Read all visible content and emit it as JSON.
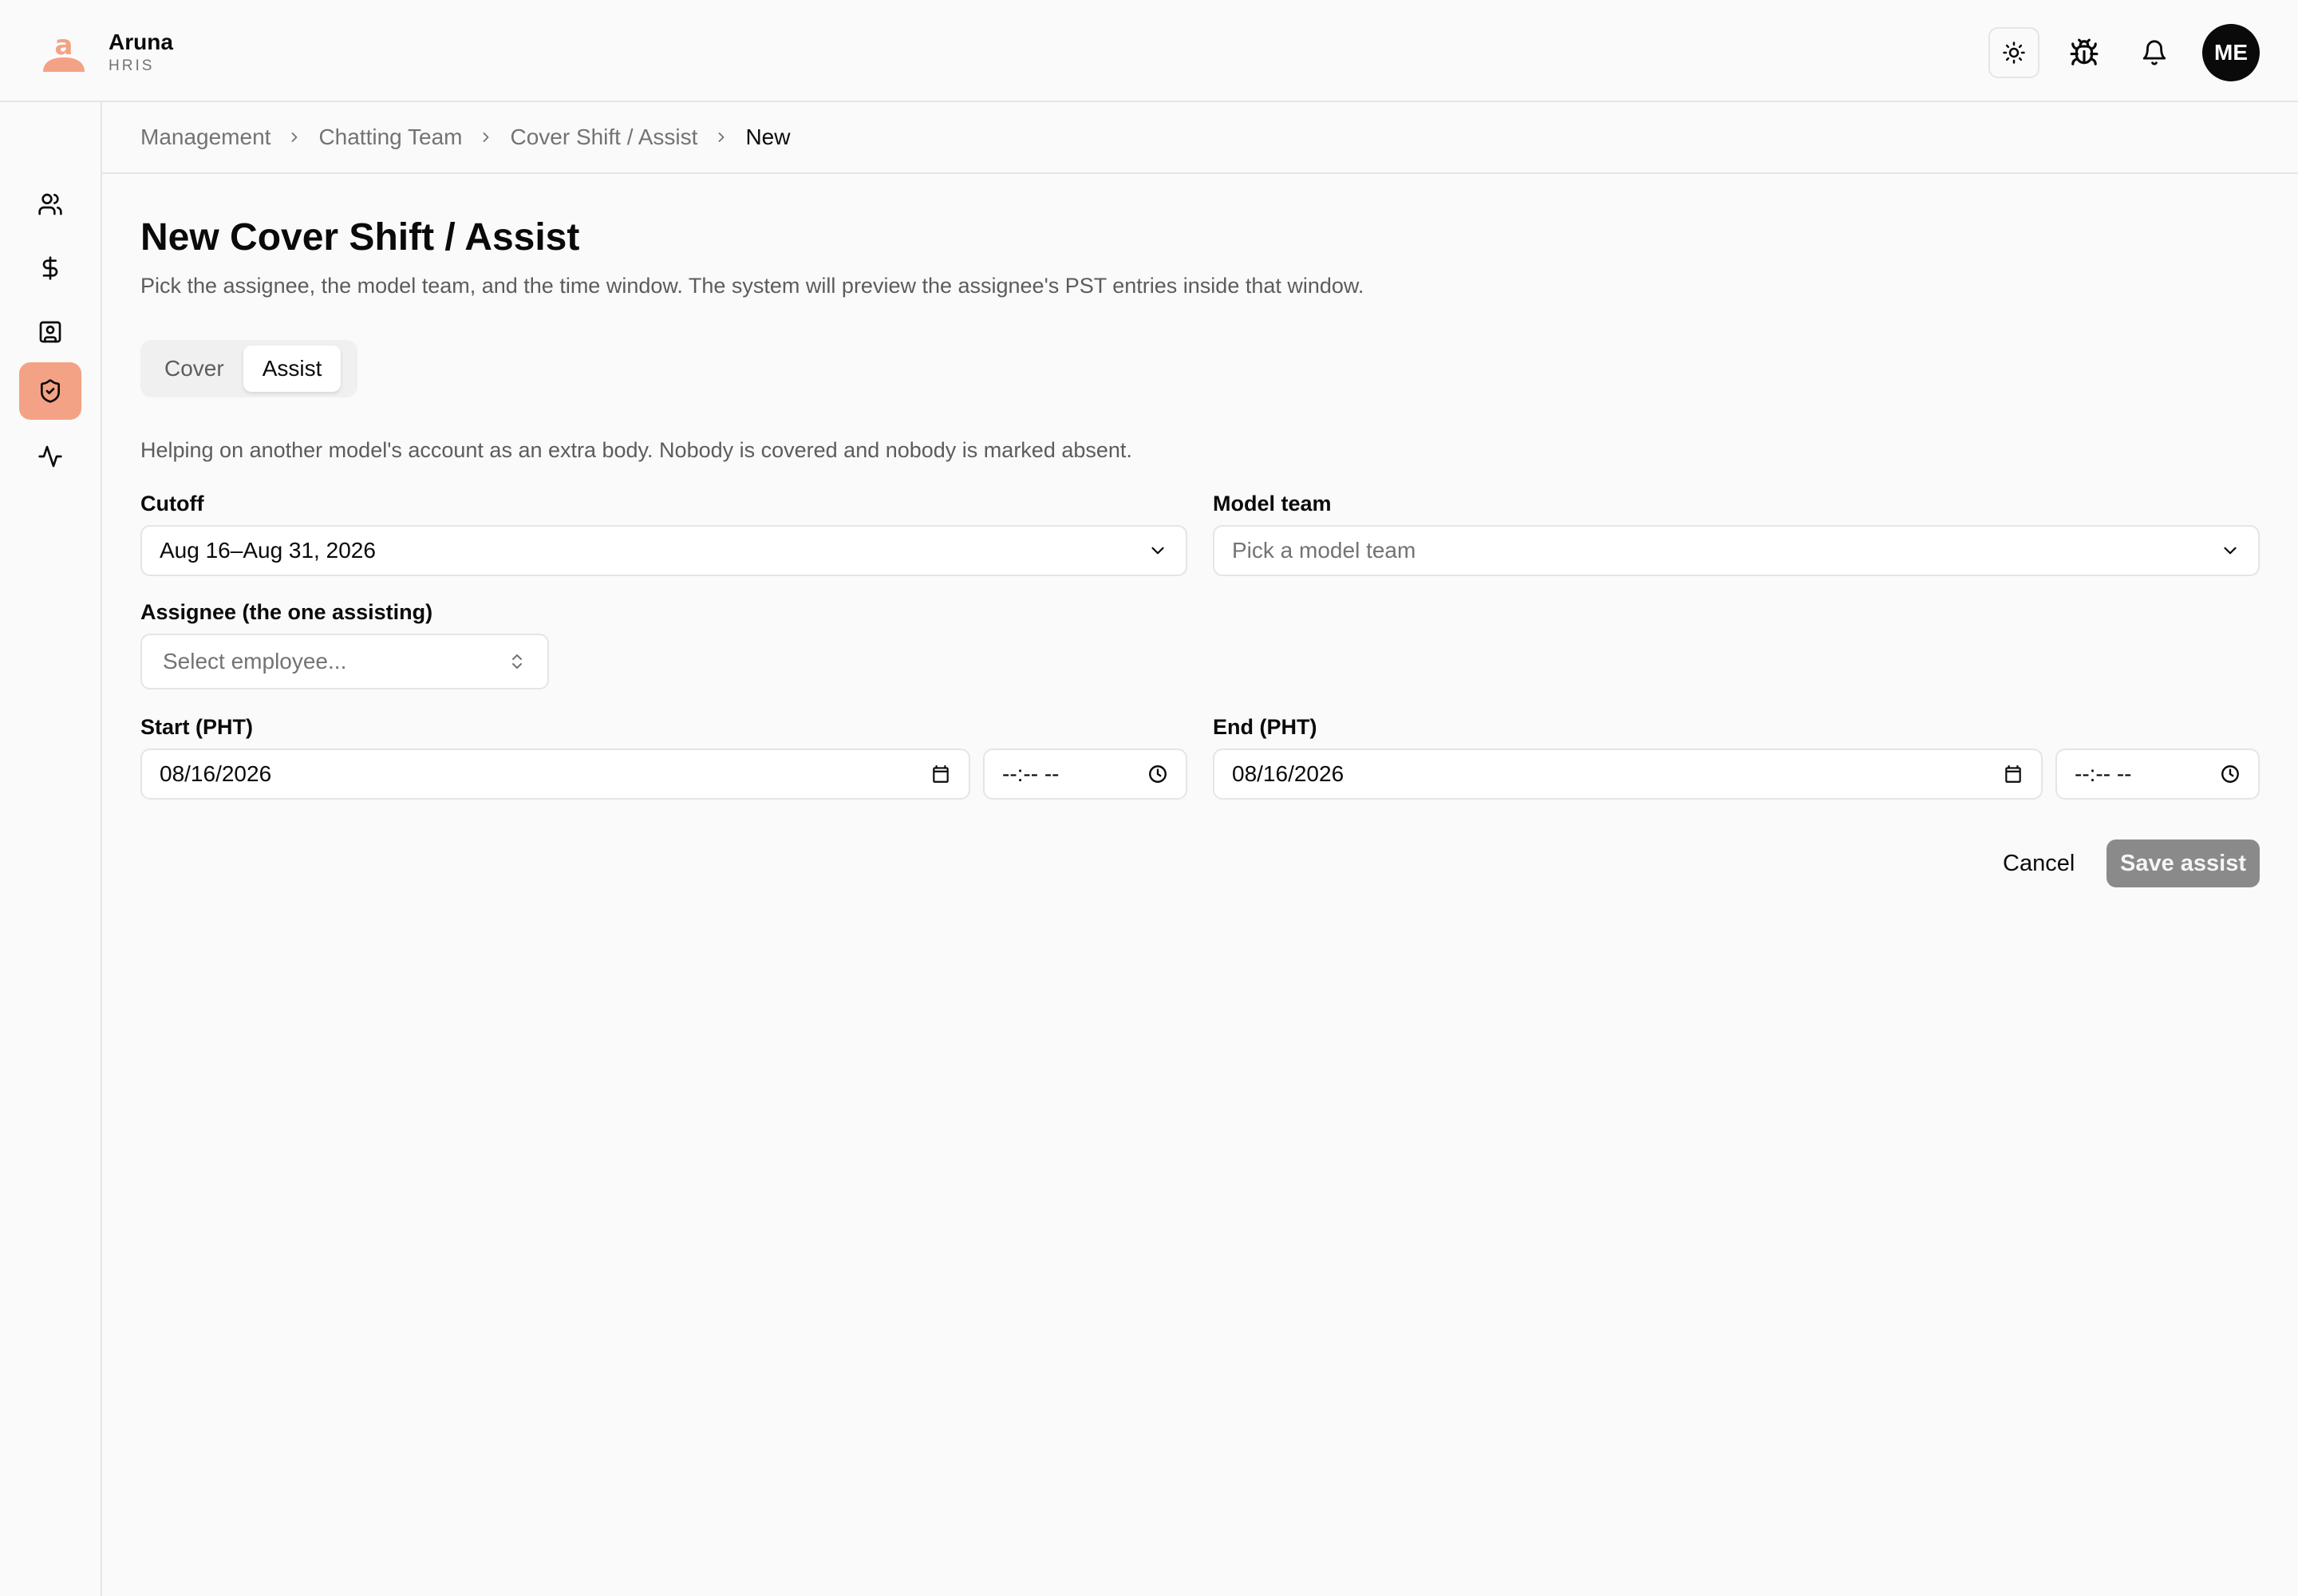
{
  "app": {
    "name": "Aruna",
    "subtitle": "HRIS",
    "accent_color": "#f4a285"
  },
  "header": {
    "theme_toggle_icon": "sun-icon",
    "bug_icon": "bug-icon",
    "notifications_icon": "bell-icon",
    "avatar_initials": "ME"
  },
  "sidebar": {
    "items": [
      {
        "icon": "users-icon",
        "active": false
      },
      {
        "icon": "dollar-icon",
        "active": false
      },
      {
        "icon": "contact-card-icon",
        "active": false
      },
      {
        "icon": "shield-check-icon",
        "active": true
      },
      {
        "icon": "activity-icon",
        "active": false
      }
    ]
  },
  "breadcrumb": [
    "Management",
    "Chatting Team",
    "Cover Shift / Assist",
    "New"
  ],
  "page": {
    "title": "New Cover Shift / Assist",
    "description": "Pick the assignee, the model team, and the time window. The system will preview the assignee's PST entries inside that window.",
    "tabs": [
      {
        "label": "Cover",
        "active": false
      },
      {
        "label": "Assist",
        "active": true
      }
    ],
    "helper_text": "Helping on another model's account as an extra body. Nobody is covered and nobody is marked absent."
  },
  "form": {
    "cutoff": {
      "label": "Cutoff",
      "value": "Aug 16–Aug 31, 2026"
    },
    "model_team": {
      "label": "Model team",
      "placeholder": "Pick a model team"
    },
    "assignee": {
      "label": "Assignee (the one assisting)",
      "placeholder": "Select employee..."
    },
    "start": {
      "label": "Start (PHT)",
      "date": "08/16/2026",
      "time": "--:-- --"
    },
    "end": {
      "label": "End (PHT)",
      "date": "08/16/2026",
      "time": "--:-- --"
    }
  },
  "actions": {
    "cancel_label": "Cancel",
    "save_label": "Save assist"
  }
}
